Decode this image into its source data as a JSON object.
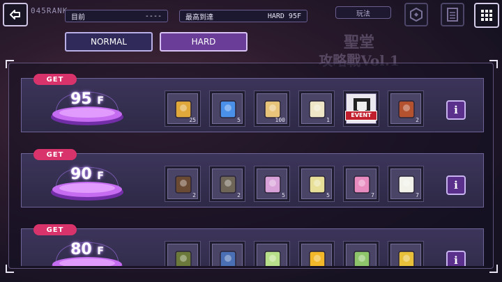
{
  "header": {
    "rank_text": "045RANK",
    "current_label": "目前",
    "current_value": "----",
    "best_label": "最高到達",
    "best_value": "HARD 95F",
    "play_label": "玩法"
  },
  "background": {
    "title_line1": "聖堂",
    "title_line2": "攻略戰Vol.1"
  },
  "tabs": {
    "normal": "NORMAL",
    "hard": "HARD",
    "selected": "HARD"
  },
  "rewards": [
    {
      "get_label": "GET",
      "floor": "95",
      "floor_unit": "F",
      "items": [
        {
          "icon": "gift-box-icon",
          "qty": "25"
        },
        {
          "icon": "blue-crystal-icon",
          "qty": "5"
        },
        {
          "icon": "character-card-icon",
          "qty": "100"
        },
        {
          "icon": "white-roses-icon",
          "qty": "1"
        },
        {
          "icon": "fist-event-icon",
          "qty": "",
          "tag": "EVENT"
        },
        {
          "icon": "red-book-icon",
          "qty": "2"
        }
      ]
    },
    {
      "get_label": "GET",
      "floor": "90",
      "floor_unit": "F",
      "items": [
        {
          "icon": "dark-book-icon",
          "qty": "2"
        },
        {
          "icon": "grey-book-icon",
          "qty": "2"
        },
        {
          "icon": "pink-flowers-icon",
          "qty": "5"
        },
        {
          "icon": "yellow-tulips-icon",
          "qty": "5"
        },
        {
          "icon": "pink-tulip-icon",
          "qty": "7"
        },
        {
          "icon": "white-tulip-icon",
          "qty": "7"
        }
      ]
    },
    {
      "get_label": "GET",
      "floor": "80",
      "floor_unit": "F",
      "items": [
        {
          "icon": "green-book-icon",
          "qty": ""
        },
        {
          "icon": "blue-book-icon",
          "qty": ""
        },
        {
          "icon": "green-flowers-icon",
          "qty": ""
        },
        {
          "icon": "sunflowers-icon",
          "qty": ""
        },
        {
          "icon": "green-bud-icon",
          "qty": ""
        },
        {
          "icon": "yellow-bud-icon",
          "qty": ""
        }
      ]
    }
  ],
  "info_label": "i",
  "colors": {
    "accent_purple": "#6a3e98",
    "get_badge": "#d9336b",
    "event_red": "#c21f2e"
  }
}
